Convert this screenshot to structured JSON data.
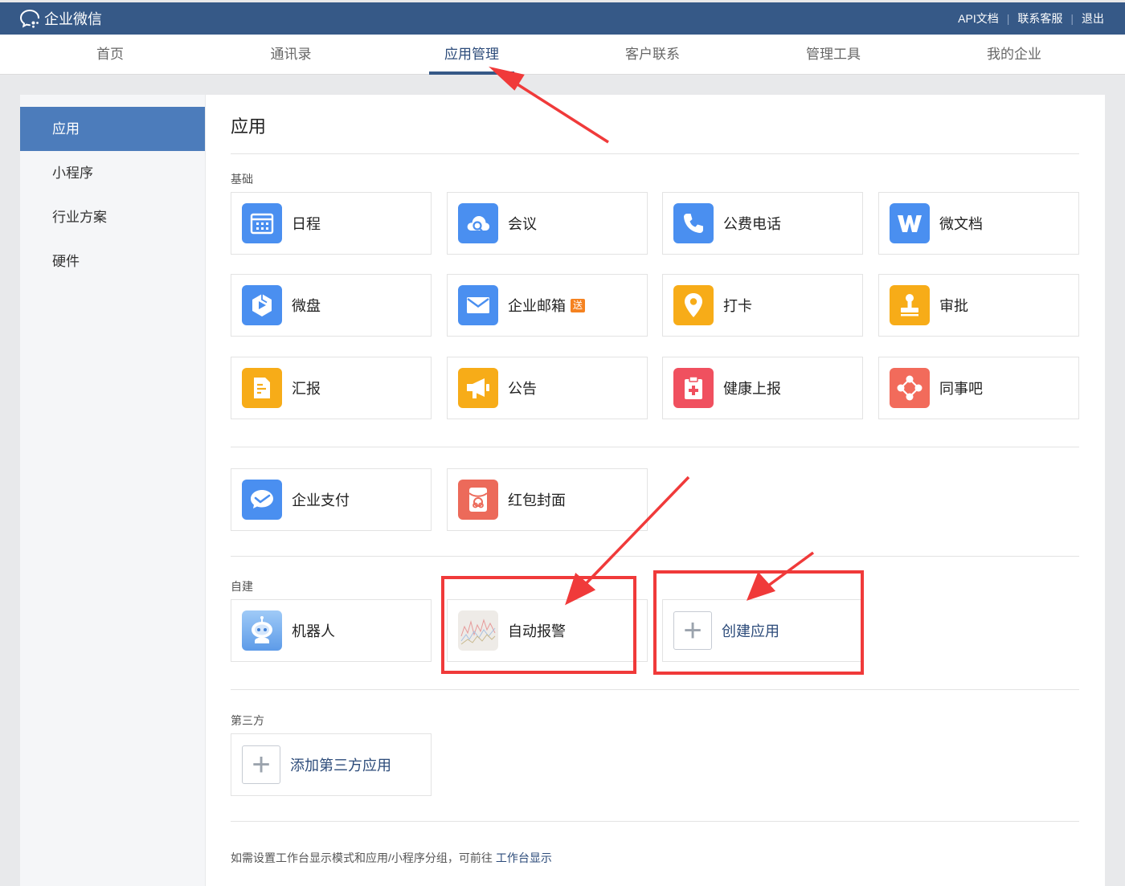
{
  "brand": {
    "name": "企业微信",
    "icon": "wecom-logo-icon"
  },
  "top_links": {
    "api": "API文档",
    "support": "联系客服",
    "logout": "退出"
  },
  "nav": {
    "home": "首页",
    "contacts": "通讯录",
    "apps": "应用管理",
    "customers": "客户联系",
    "tools": "管理工具",
    "company": "我的企业",
    "active": "应用管理"
  },
  "sidebar": {
    "apps": "应用",
    "miniprogram": "小程序",
    "industry": "行业方案",
    "hardware": "硬件",
    "active": "应用"
  },
  "main": {
    "title": "应用",
    "sections": {
      "basic": "基础",
      "custom": "自建",
      "third_party": "第三方"
    },
    "apps": {
      "schedule": {
        "label": "日程",
        "color": "#4a8ff0",
        "icon": "calendar-icon"
      },
      "meeting": {
        "label": "会议",
        "color": "#4a8ff0",
        "icon": "cloud-meeting-icon"
      },
      "phone": {
        "label": "公费电话",
        "color": "#4a8ff0",
        "icon": "phone-icon"
      },
      "doc": {
        "label": "微文档",
        "color": "#4a8ff0",
        "icon": "w-doc-icon"
      },
      "drive": {
        "label": "微盘",
        "color": "#4a8ff0",
        "icon": "drive-icon"
      },
      "mail": {
        "label": "企业邮箱",
        "color": "#4a8ff0",
        "icon": "mail-icon",
        "badge": "送"
      },
      "checkin": {
        "label": "打卡",
        "color": "#f7ac18",
        "icon": "location-pin-icon"
      },
      "approval": {
        "label": "审批",
        "color": "#f7ac18",
        "icon": "stamp-icon"
      },
      "report": {
        "label": "汇报",
        "color": "#f7ac18",
        "icon": "report-doc-icon"
      },
      "notice": {
        "label": "公告",
        "color": "#f7ac18",
        "icon": "megaphone-icon"
      },
      "health": {
        "label": "健康上报",
        "color": "#f0505f",
        "icon": "medical-clipboard-icon"
      },
      "colleague": {
        "label": "同事吧",
        "color": "#f26b5b",
        "icon": "network-icon"
      },
      "pay": {
        "label": "企业支付",
        "color": "#4a8ff0",
        "icon": "payment-icon"
      },
      "redpacket": {
        "label": "红包封面",
        "color": "#ec6a5a",
        "icon": "red-packet-icon"
      },
      "robot": {
        "label": "机器人",
        "color": "#7fb5f0",
        "icon": "robot-icon"
      },
      "alarm": {
        "label": "自动报警",
        "color": "#e6e2dc",
        "icon": "chart-thumbnail-icon"
      }
    },
    "create_app": "创建应用",
    "add_third_party": "添加第三方应用",
    "footnote": {
      "text": "如需设置工作台显示模式和应用/小程序分组，可前往",
      "link": "工作台显示"
    }
  },
  "annotations": {
    "highlight_color": "#f03a3a"
  }
}
